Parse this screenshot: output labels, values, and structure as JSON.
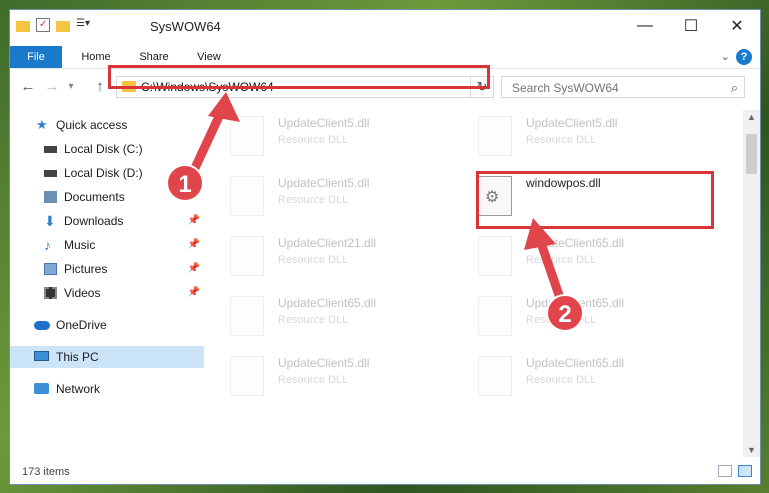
{
  "window": {
    "title": "SysWOW64",
    "controls": {
      "minimize": "—",
      "maximize": "☐",
      "close": "✕"
    }
  },
  "ribbon": {
    "tabs": [
      "File",
      "Home",
      "Share",
      "View"
    ],
    "help": "?"
  },
  "nav": {
    "back": "←",
    "forward": "→",
    "recent": "▾",
    "up": "↑",
    "address": "C:\\Windows\\SysWOW64",
    "search_placeholder": "Search SysWOW64"
  },
  "sidebar": {
    "items": [
      {
        "label": "Quick access",
        "icon": "star-icon",
        "pinned": false
      },
      {
        "label": "Local Disk (C:)",
        "icon": "drive-icon",
        "pinned": false
      },
      {
        "label": "Local Disk (D:)",
        "icon": "drive-icon",
        "pinned": false
      },
      {
        "label": "Documents",
        "icon": "documents-icon",
        "pinned": true
      },
      {
        "label": "Downloads",
        "icon": "download-icon",
        "pinned": true
      },
      {
        "label": "Music",
        "icon": "music-icon",
        "pinned": true
      },
      {
        "label": "Pictures",
        "icon": "pictures-icon",
        "pinned": true
      },
      {
        "label": "Videos",
        "icon": "videos-icon",
        "pinned": true
      },
      {
        "label": "OneDrive",
        "icon": "cloud-icon",
        "pinned": false
      },
      {
        "label": "This PC",
        "icon": "computer-icon",
        "pinned": false,
        "selected": true
      },
      {
        "label": "Network",
        "icon": "network-icon",
        "pinned": false
      }
    ],
    "pin_glyph": "📌"
  },
  "files": [
    {
      "name": "UpdateClient5.dll",
      "type": "Resource DLL",
      "faded": true
    },
    {
      "name": "UpdateClient5.dll",
      "type": "Resource DLL",
      "faded": true
    },
    {
      "name": "UpdateClient5.dll",
      "type": "Resource DLL",
      "faded": true
    },
    {
      "name": "windowpos.dll",
      "type": "",
      "faded": false,
      "highlighted": true
    },
    {
      "name": "UpdateClient21.dll",
      "type": "Resource DLL",
      "faded": true
    },
    {
      "name": "UpdateClient65.dll",
      "type": "Resource DLL",
      "faded": true
    },
    {
      "name": "UpdateClient65.dll",
      "type": "Resource DLL",
      "faded": true
    },
    {
      "name": "UpdateClient65.dll",
      "type": "Resource DLL",
      "faded": true
    },
    {
      "name": "UpdateClient5.dll",
      "type": "Resource DLL",
      "faded": true
    },
    {
      "name": "UpdateClient65.dll",
      "type": "Resource DLL",
      "faded": true
    }
  ],
  "status": {
    "item_count": "173 items"
  },
  "callouts": [
    "1",
    "2"
  ],
  "colors": {
    "accent": "#1979ca",
    "highlight": "#d9343a",
    "callout": "#e0454b",
    "selection": "#cce4f7"
  }
}
